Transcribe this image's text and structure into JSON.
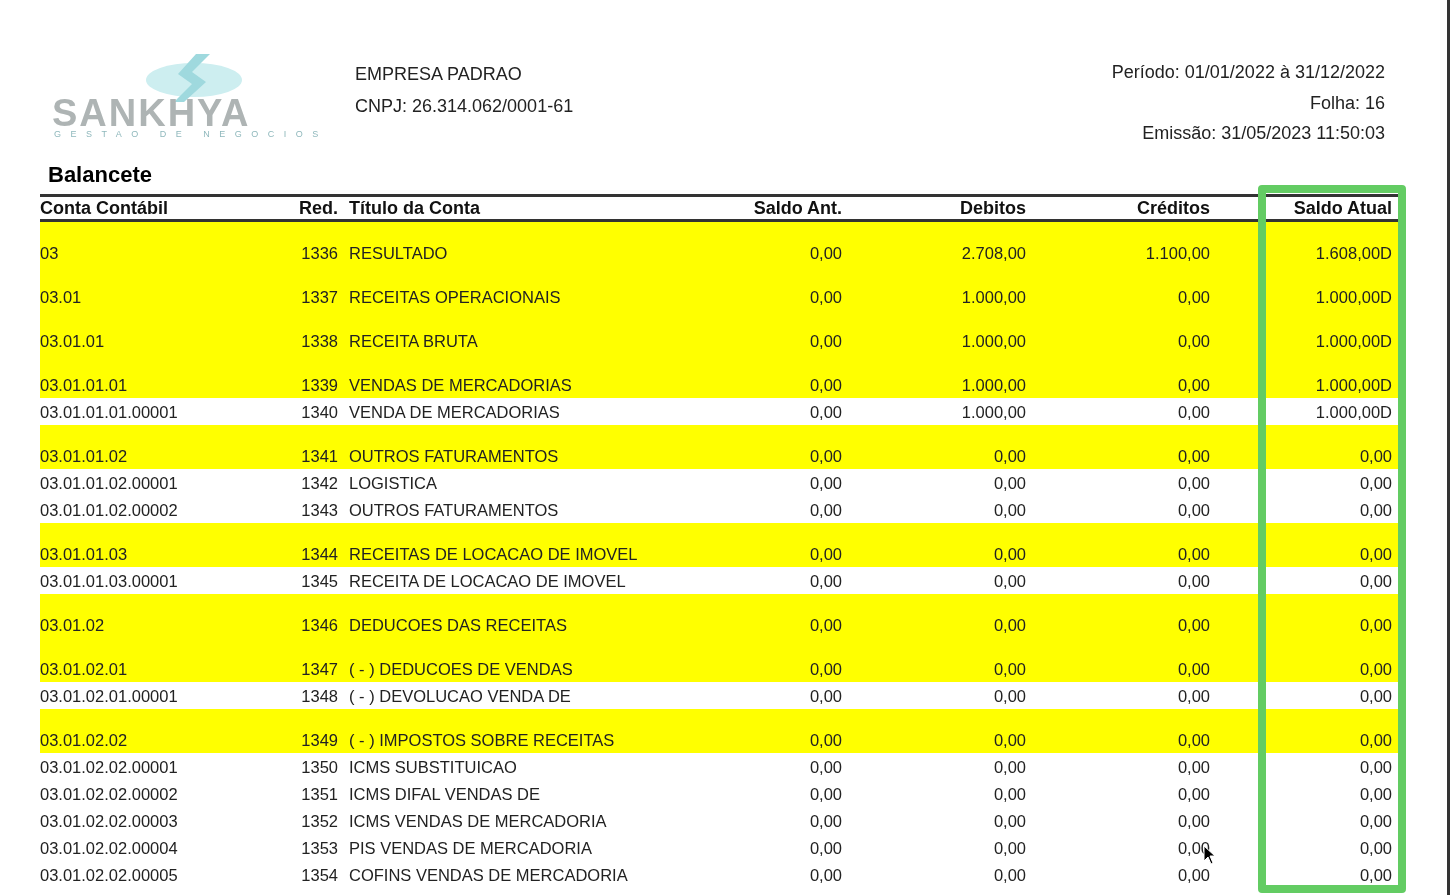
{
  "logo": {
    "name": "SANKHYA",
    "tagline": "GESTAO DE NEGOCIOS"
  },
  "company": {
    "name": "EMPRESA PADRAO",
    "cnpj": "CNPJ: 26.314.062/0001-61"
  },
  "meta": {
    "period": "Período: 01/01/2022 à 31/12/2022",
    "sheet": "Folha: 16",
    "issued": "Emissão: 31/05/2023 11:50:03"
  },
  "report_title": "Balancete",
  "table": {
    "columns": [
      {
        "label": "Conta Contábil",
        "highlighted": false
      },
      {
        "label": "Red.",
        "highlighted": false
      },
      {
        "label": "Título da Conta",
        "highlighted": false
      },
      {
        "label": "Saldo Ant.",
        "highlighted": false
      },
      {
        "label": "Debitos",
        "highlighted": false
      },
      {
        "label": "Créditos",
        "highlighted": false
      },
      {
        "label": "Saldo Atual",
        "highlighted": true
      }
    ],
    "rows": [
      {
        "kind": "group",
        "cells": [
          "03",
          "1336",
          "RESULTADO",
          "0,00",
          "2.708,00",
          "1.100,00",
          "1.608,00D"
        ]
      },
      {
        "kind": "group",
        "cells": [
          "03.01",
          "1337",
          "RECEITAS OPERACIONAIS",
          "0,00",
          "1.000,00",
          "0,00",
          "1.000,00D"
        ]
      },
      {
        "kind": "group",
        "cells": [
          "03.01.01",
          "1338",
          "RECEITA BRUTA",
          "0,00",
          "1.000,00",
          "0,00",
          "1.000,00D"
        ]
      },
      {
        "kind": "group",
        "cells": [
          "03.01.01.01",
          "1339",
          "VENDAS DE MERCADORIAS",
          "0,00",
          "1.000,00",
          "0,00",
          "1.000,00D"
        ]
      },
      {
        "kind": "account",
        "cells": [
          "03.01.01.01.00001",
          "1340",
          "VENDA DE MERCADORIAS",
          "0,00",
          "1.000,00",
          "0,00",
          "1.000,00D"
        ]
      },
      {
        "kind": "group",
        "cells": [
          "03.01.01.02",
          "1341",
          "OUTROS FATURAMENTOS",
          "0,00",
          "0,00",
          "0,00",
          "0,00"
        ]
      },
      {
        "kind": "account",
        "cells": [
          "03.01.01.02.00001",
          "1342",
          "LOGISTICA",
          "0,00",
          "0,00",
          "0,00",
          "0,00"
        ]
      },
      {
        "kind": "account",
        "cells": [
          "03.01.01.02.00002",
          "1343",
          "OUTROS FATURAMENTOS",
          "0,00",
          "0,00",
          "0,00",
          "0,00"
        ]
      },
      {
        "kind": "group",
        "cells": [
          "03.01.01.03",
          "1344",
          "RECEITAS DE LOCACAO DE IMOVEL",
          "0,00",
          "0,00",
          "0,00",
          "0,00"
        ]
      },
      {
        "kind": "account",
        "cells": [
          "03.01.01.03.00001",
          "1345",
          "RECEITA DE LOCACAO DE IMOVEL",
          "0,00",
          "0,00",
          "0,00",
          "0,00"
        ]
      },
      {
        "kind": "group",
        "cells": [
          "03.01.02",
          "1346",
          "DEDUCOES DAS RECEITAS",
          "0,00",
          "0,00",
          "0,00",
          "0,00"
        ]
      },
      {
        "kind": "group",
        "cells": [
          "03.01.02.01",
          "1347",
          "( - ) DEDUCOES DE VENDAS",
          "0,00",
          "0,00",
          "0,00",
          "0,00"
        ]
      },
      {
        "kind": "account",
        "cells": [
          "03.01.02.01.00001",
          "1348",
          "( - ) DEVOLUCAO VENDA DE",
          "0,00",
          "0,00",
          "0,00",
          "0,00"
        ]
      },
      {
        "kind": "group",
        "cells": [
          "03.01.02.02",
          "1349",
          "( - ) IMPOSTOS SOBRE RECEITAS",
          "0,00",
          "0,00",
          "0,00",
          "0,00"
        ]
      },
      {
        "kind": "account",
        "cells": [
          "03.01.02.02.00001",
          "1350",
          "ICMS SUBSTITUICAO",
          "0,00",
          "0,00",
          "0,00",
          "0,00"
        ]
      },
      {
        "kind": "account",
        "cells": [
          "03.01.02.02.00002",
          "1351",
          "ICMS DIFAL VENDAS DE",
          "0,00",
          "0,00",
          "0,00",
          "0,00"
        ]
      },
      {
        "kind": "account",
        "cells": [
          "03.01.02.02.00003",
          "1352",
          "ICMS VENDAS DE MERCADORIA",
          "0,00",
          "0,00",
          "0,00",
          "0,00"
        ]
      },
      {
        "kind": "account",
        "cells": [
          "03.01.02.02.00004",
          "1353",
          "PIS VENDAS DE MERCADORIA",
          "0,00",
          "0,00",
          "0,00",
          "0,00"
        ]
      },
      {
        "kind": "account",
        "cells": [
          "03.01.02.02.00005",
          "1354",
          "COFINS VENDAS DE MERCADORIA",
          "0,00",
          "0,00",
          "0,00",
          "0,00"
        ]
      }
    ]
  }
}
